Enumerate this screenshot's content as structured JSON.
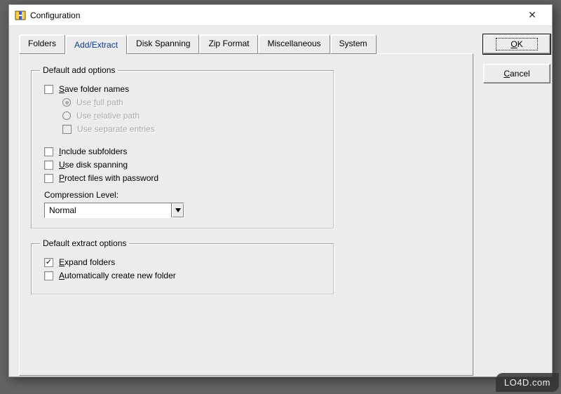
{
  "window": {
    "title": "Configuration",
    "close_glyph": "✕"
  },
  "tabs": {
    "folders": "Folders",
    "add_extract": "Add/Extract",
    "disk_spanning": "Disk Spanning",
    "zip_format": "Zip Format",
    "misc": "Miscellaneous",
    "system": "System",
    "active": "add_extract"
  },
  "group_add": {
    "legend": "Default add options",
    "save_folder_names": {
      "label": "Save folder names",
      "checked": false,
      "accel_index": 0
    },
    "use_full_path": {
      "label": "Use full path",
      "selected": true,
      "disabled": true,
      "accel_index": 4
    },
    "use_relative_path": {
      "label": "Use relative path",
      "selected": false,
      "disabled": true,
      "accel_index": 4
    },
    "use_separate_entries": {
      "label": "Use separate entries",
      "checked": false,
      "disabled": true
    },
    "include_subfolders": {
      "label": "Include subfolders",
      "checked": false,
      "accel_index": 0
    },
    "use_disk_spanning": {
      "label": "Use disk spanning",
      "checked": false,
      "accel_index": 0
    },
    "protect_password": {
      "label": "Protect files with password",
      "checked": false,
      "accel_index": 0
    },
    "compression_label": "Compression Level:",
    "compression_value": "Normal"
  },
  "group_extract": {
    "legend": "Default extract options",
    "expand_folders": {
      "label": "Expand folders",
      "checked": true,
      "accel_index": 0
    },
    "auto_create_folder": {
      "label": "Automatically create new folder",
      "checked": false,
      "accel_index": 0
    }
  },
  "buttons": {
    "ok": "OK",
    "cancel": "Cancel"
  },
  "watermark": "LO4D.com"
}
